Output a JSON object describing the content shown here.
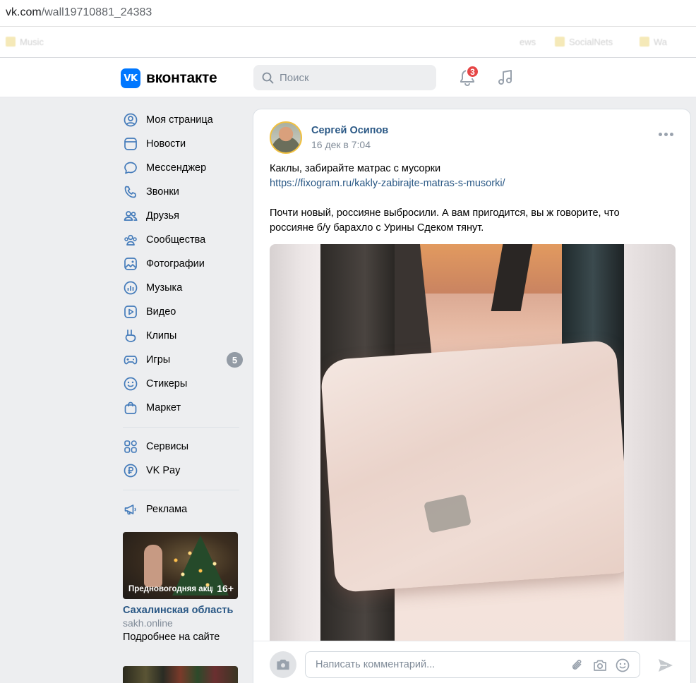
{
  "browser": {
    "url_host": "vk.com",
    "url_path": "/wall19710881_24383",
    "bookmarks": [
      "Music",
      "ews",
      "SocialNets",
      "Wa"
    ]
  },
  "header": {
    "logo_text": "вконтакте",
    "logo_mark": "VK",
    "search_placeholder": "Поиск",
    "notifications_count": "3"
  },
  "sidebar": {
    "items": [
      {
        "label": "Моя страница",
        "icon": "user-circle-icon"
      },
      {
        "label": "Новости",
        "icon": "news-icon"
      },
      {
        "label": "Мессенджер",
        "icon": "message-icon"
      },
      {
        "label": "Звонки",
        "icon": "phone-icon"
      },
      {
        "label": "Друзья",
        "icon": "friends-icon"
      },
      {
        "label": "Сообщества",
        "icon": "communities-icon"
      },
      {
        "label": "Фотографии",
        "icon": "photo-icon"
      },
      {
        "label": "Музыка",
        "icon": "music-icon"
      },
      {
        "label": "Видео",
        "icon": "video-icon"
      },
      {
        "label": "Клипы",
        "icon": "clips-icon"
      },
      {
        "label": "Игры",
        "icon": "games-icon",
        "badge": "5"
      },
      {
        "label": "Стикеры",
        "icon": "smile-icon"
      },
      {
        "label": "Маркет",
        "icon": "market-icon"
      }
    ],
    "items2": [
      {
        "label": "Сервисы",
        "icon": "services-icon"
      },
      {
        "label": "VK Pay",
        "icon": "ruble-icon"
      }
    ],
    "items3": [
      {
        "label": "Реклама",
        "icon": "megaphone-icon"
      }
    ]
  },
  "ad": {
    "caption": "Предновогодняя акция",
    "age": "16+",
    "title": "Сахалинская область",
    "domain": "sakh.online",
    "more": "Подробнее на сайте"
  },
  "post": {
    "author": "Сергей Осипов",
    "date": "16 дек в 7:04",
    "line1": "Каклы, забирайте матрас с мусорки",
    "link": "https://fixogram.ru/kakly-zabirajte-matras-s-musorki/",
    "paragraph2": "Почти новый, россияне выбросили. А вам пригодится, вы ж говорите, что россияне б/у барахло с Урины Сдеком тянут.",
    "comment_placeholder": "Написать комментарий..."
  },
  "colors": {
    "accent": "#0077ff",
    "link": "#2a5885",
    "badge_red": "#e64646",
    "icon": "#447bba"
  }
}
